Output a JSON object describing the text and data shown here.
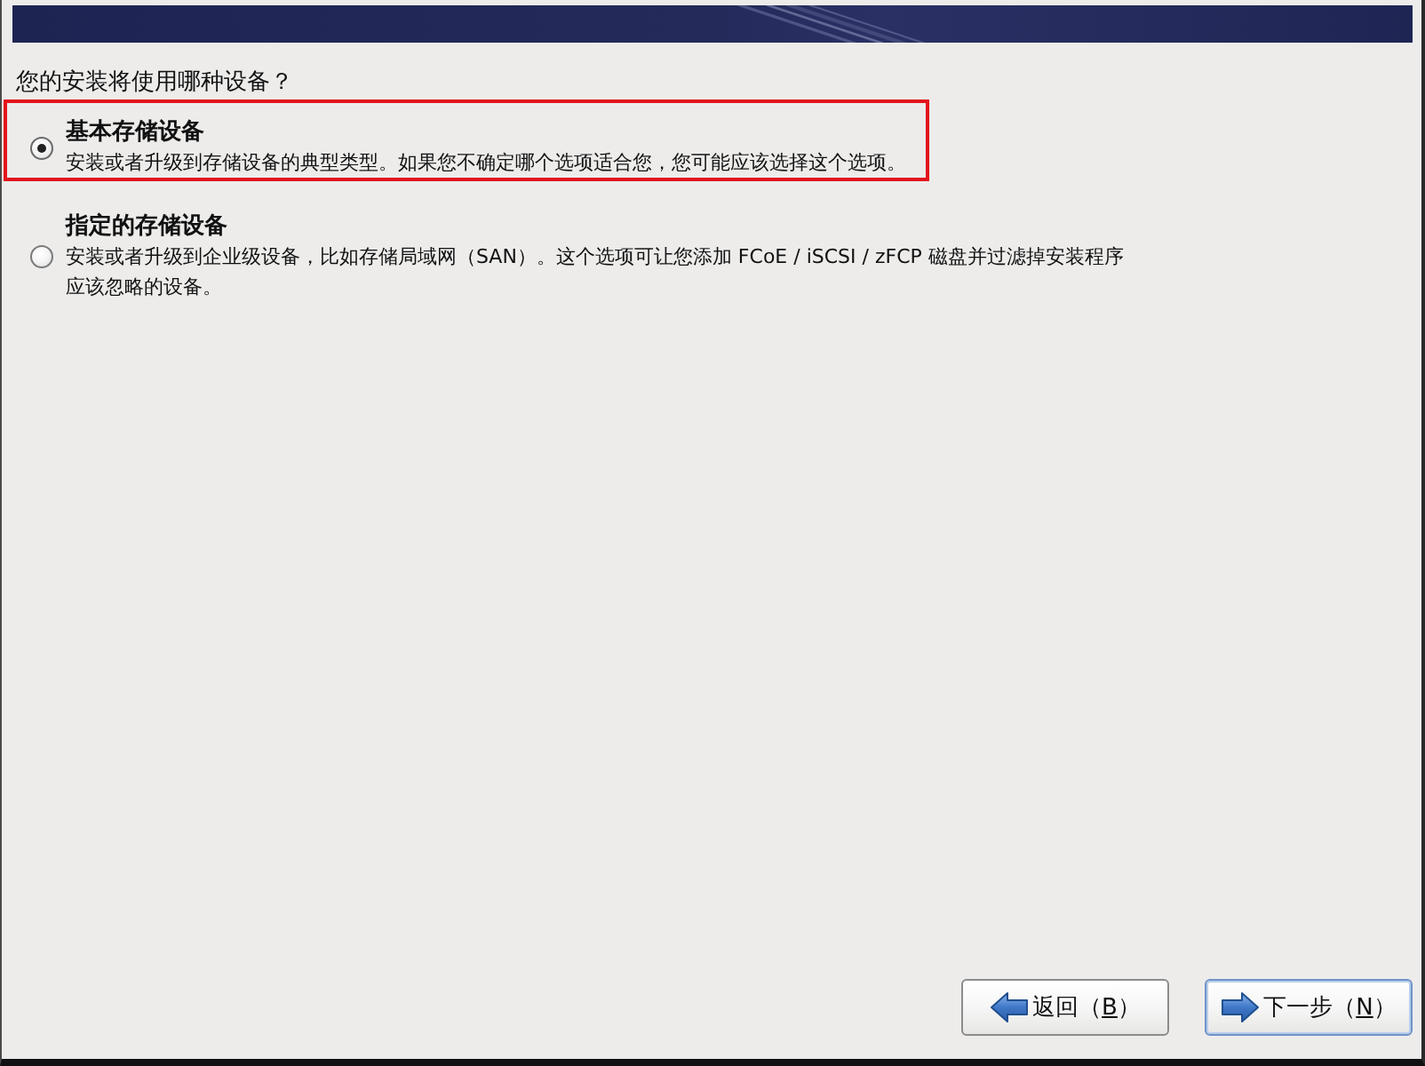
{
  "question": "您的安装将使用哪种设备？",
  "options": [
    {
      "title": "基本存储设备",
      "description": "安装或者升级到存储设备的典型类型。如果您不确定哪个选项适合您，您可能应该选择这个选项。",
      "selected": true,
      "highlighted": true
    },
    {
      "title": "指定的存储设备",
      "description": "安装或者升级到企业级设备，比如存储局域网（SAN）。这个选项可让您添加 FCoE / iSCSI / zFCP 磁盘并过滤掉安装程序应该忽略的设备。",
      "selected": false,
      "highlighted": false
    }
  ],
  "buttons": [
    {
      "kind": "back",
      "label_before": "返回（",
      "mnemonic": "B",
      "label_after": "）",
      "focused": false
    },
    {
      "kind": "next",
      "label_before": "下一步（",
      "mnemonic": "N",
      "label_after": "）",
      "focused": true
    }
  ]
}
